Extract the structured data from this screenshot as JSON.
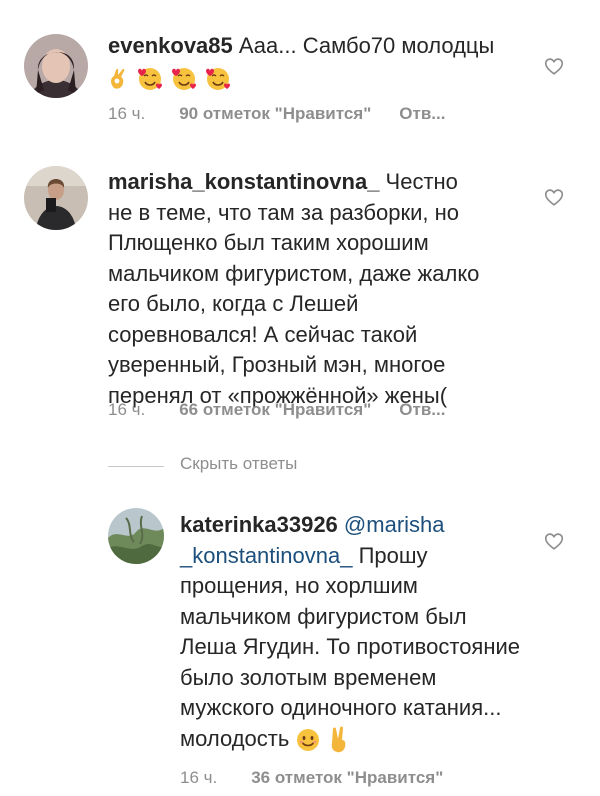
{
  "comments": [
    {
      "username": "evenkova85",
      "text": " Ааа... Самбо70 молодцы",
      "time": "16 ч.",
      "likes": "90 отметок \"Нравится\"",
      "reply": "Отв..."
    },
    {
      "username": "marisha_konstantinovna_",
      "text": " Честно не в теме, что там за разборки, но Плющенко был таким хорошим мальчиком фигуристом, даже жалко его было, когда с Лешей соревновался! А сейчас такой уверенный, Грозный мэн, многое перенял от «прожжённой» жены(",
      "time": "16 ч.",
      "likes": "66 отметок \"Нравится\"",
      "reply": "Отв..."
    }
  ],
  "hide_replies": "Скрыть ответы",
  "reply_comment": {
    "username": "katerinka33926",
    "mention": "@marisha _konstantinovna_",
    "text": "  Прошу прощения, но хорлшим мальчиком  фигуристом был Леша Ягудин. То противостояние было золотым временем  мужского одиночного  катания... молодость",
    "time": "16 ч.",
    "likes": "36 отметок \"Нравится\""
  },
  "icons": {
    "like": "heart-outline-icon",
    "emoji_ok": "ok-hand-emoji",
    "emoji_love": "smiling-face-with-hearts-emoji",
    "emoji_smile": "smiling-face-emoji",
    "emoji_victory": "victory-hand-emoji"
  }
}
